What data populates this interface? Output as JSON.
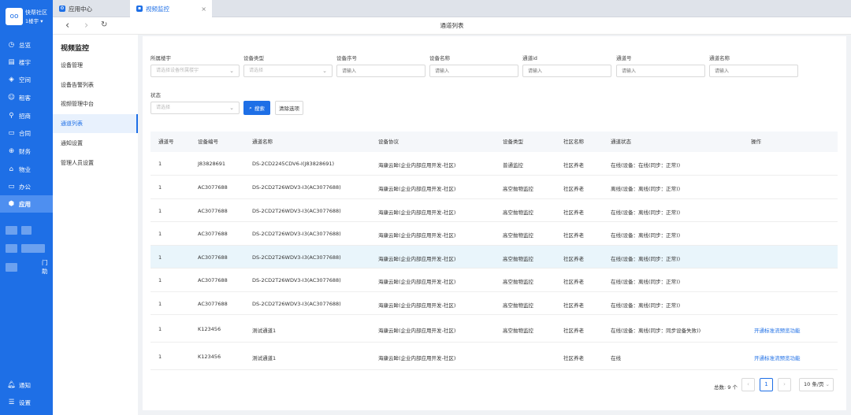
{
  "app": {
    "brand_name": "快帮社区",
    "brand_sub": "1楼宇 ▾",
    "brand_logo": "oo",
    "nav": [
      {
        "label": "总览",
        "icon": "clock-icon"
      },
      {
        "label": "楼宇",
        "icon": "building-icon"
      },
      {
        "label": "空间",
        "icon": "cube-icon"
      },
      {
        "label": "租客",
        "icon": "people-icon"
      },
      {
        "label": "招商",
        "icon": "handshake-icon"
      },
      {
        "label": "合同",
        "icon": "contract-icon"
      },
      {
        "label": "财务",
        "icon": "finance-icon"
      },
      {
        "label": "物业",
        "icon": "home-icon"
      },
      {
        "label": "办公",
        "icon": "monitor-icon"
      },
      {
        "label": "应用",
        "icon": "app-icon"
      }
    ],
    "extra_nav_label": "门助",
    "bottom_nav": [
      {
        "label": "通知",
        "icon": "bell-icon"
      },
      {
        "label": "设置",
        "icon": "menu-icon"
      }
    ]
  },
  "tabs": [
    {
      "label": "应用中心"
    },
    {
      "label": "视频监控",
      "close": "×"
    }
  ],
  "toolbar": {
    "back": "‹",
    "forward": "›",
    "refresh": "↻",
    "title": "通道列表"
  },
  "subnav": {
    "title": "视频监控",
    "items": [
      "设备管理",
      "设备告警列表",
      "视频管理中台",
      "通道列表",
      "通知设置",
      "管理人员设置"
    ]
  },
  "filters": {
    "building": {
      "label": "所属楼宇",
      "placeholder": "请选择设备所属楼宇"
    },
    "device_type": {
      "label": "设备类型",
      "placeholder": "请选择"
    },
    "device_serial": {
      "label": "设备序号",
      "placeholder": "请输入"
    },
    "device_name": {
      "label": "设备名称",
      "placeholder": "请输入"
    },
    "channel_id": {
      "label": "通道id",
      "placeholder": "请输入"
    },
    "channel_no": {
      "label": "通道号",
      "placeholder": "请输入"
    },
    "channel_name": {
      "label": "通道名称",
      "placeholder": "请输入"
    },
    "status": {
      "label": "状态",
      "placeholder": "请选择"
    },
    "search_btn": "搜索",
    "clear_btn": "清除选项"
  },
  "table": {
    "headers": [
      "通道号",
      "设备编号",
      "通道名称",
      "设备协议",
      "设备类型",
      "社区名称",
      "通道状态",
      "操作"
    ],
    "rows": [
      {
        "no": "1",
        "code": "J83828691",
        "name": "DS-2CD2245CDV6-I(J83828691)",
        "protocol": "海康云眸(企业内部应用开发-社区)",
        "type": "普通监控",
        "community": "社区养老",
        "status": "在线(设备：在线(同步：正常))",
        "action": ""
      },
      {
        "no": "1",
        "code": "AC3077688",
        "name": "DS-2CD2T26WDV3-I3(AC3077688)",
        "protocol": "海康云眸(企业内部应用开发-社区)",
        "type": "高空抛物监控",
        "community": "社区养老",
        "status": "离线(设备：离线(同步：正常))",
        "action": ""
      },
      {
        "no": "1",
        "code": "AC3077688",
        "name": "DS-2CD2T26WDV3-I3(AC3077688)",
        "protocol": "海康云眸(企业内部应用开发-社区)",
        "type": "高空抛物监控",
        "community": "社区养老",
        "status": "在线(设备：离线(同步：正常))",
        "action": ""
      },
      {
        "no": "1",
        "code": "AC3077688",
        "name": "DS-2CD2T26WDV3-I3(AC3077688)",
        "protocol": "海康云眸(企业内部应用开发-社区)",
        "type": "高空抛物监控",
        "community": "社区养老",
        "status": "在线(设备：离线(同步：正常))",
        "action": ""
      },
      {
        "no": "1",
        "code": "AC3077688",
        "name": "DS-2CD2T26WDV3-I3(AC3077688)",
        "protocol": "海康云眸(企业内部应用开发-社区)",
        "type": "高空抛物监控",
        "community": "社区养老",
        "status": "在线(设备：离线(同步：正常))",
        "action": ""
      },
      {
        "no": "1",
        "code": "AC3077688",
        "name": "DS-2CD2T26WDV3-I3(AC3077688)",
        "protocol": "海康云眸(企业内部应用开发-社区)",
        "type": "高空抛物监控",
        "community": "社区养老",
        "status": "在线(设备：离线(同步：正常))",
        "action": ""
      },
      {
        "no": "1",
        "code": "AC3077688",
        "name": "DS-2CD2T26WDV3-I3(AC3077688)",
        "protocol": "海康云眸(企业内部应用开发-社区)",
        "type": "高空抛物监控",
        "community": "社区养老",
        "status": "在线(设备：离线(同步：正常))",
        "action": ""
      },
      {
        "no": "1",
        "code": "K123456",
        "name": "测试通道1",
        "protocol": "海康云眸(企业内部应用开发-社区)",
        "type": "高空抛物监控",
        "community": "社区养老",
        "status": "在线(设备：离线(同步：同步设备失败))",
        "action": "开通标准流预览功能"
      },
      {
        "no": "1",
        "code": "K123456",
        "name": "测试通道1",
        "protocol": "海康云眸(企业内部应用开发-社区)",
        "type": "",
        "community": "社区养老",
        "status": "在线",
        "action": "开通标准流预览功能"
      }
    ]
  },
  "pagination": {
    "total": "总数: 9 个",
    "prev": "‹",
    "current": "1",
    "next": "›",
    "size": "10 条/页"
  }
}
